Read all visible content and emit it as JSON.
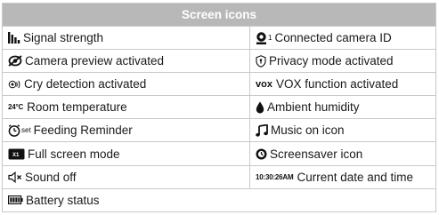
{
  "table": {
    "title": "Screen icons",
    "rows": [
      {
        "left": {
          "icon": "signal-strength-icon",
          "label": "Signal strength"
        },
        "right": {
          "icon": "camera-id-icon",
          "icon_text": "1",
          "label": "Connected camera ID"
        }
      },
      {
        "left": {
          "icon": "camera-preview-icon",
          "label": "Camera preview activated"
        },
        "right": {
          "icon": "privacy-shield-icon",
          "label": "Privacy mode activated"
        }
      },
      {
        "left": {
          "icon": "cry-detection-icon",
          "label": "Cry detection activated"
        },
        "right": {
          "icon": "vox-icon",
          "icon_text": "vox",
          "label": "VOX function activated"
        }
      },
      {
        "left": {
          "icon": "temperature-icon",
          "icon_text": "24°C",
          "label": "Room temperature"
        },
        "right": {
          "icon": "humidity-drop-icon",
          "label": "Ambient humidity"
        }
      },
      {
        "left": {
          "icon": "feeding-clock-icon",
          "icon_text": "set",
          "label": "Feeding Reminder"
        },
        "right": {
          "icon": "music-note-icon",
          "label": "Music on icon"
        }
      },
      {
        "left": {
          "icon": "full-screen-icon",
          "icon_text": "X1",
          "label": "Full screen mode"
        },
        "right": {
          "icon": "screensaver-icon",
          "label": "Screensaver icon"
        }
      },
      {
        "left": {
          "icon": "sound-off-icon",
          "label": "Sound off"
        },
        "right": {
          "icon": "clock-readout-icon",
          "icon_text": "10:30:26AM",
          "label": "Current date and time"
        }
      },
      {
        "left": {
          "icon": "battery-icon",
          "label": "Battery status"
        }
      }
    ]
  },
  "colors": {
    "header_bg": "#b8b8b8",
    "header_text": "#ffffff",
    "border": "#c9c9c9",
    "text": "#1a1a1a"
  }
}
